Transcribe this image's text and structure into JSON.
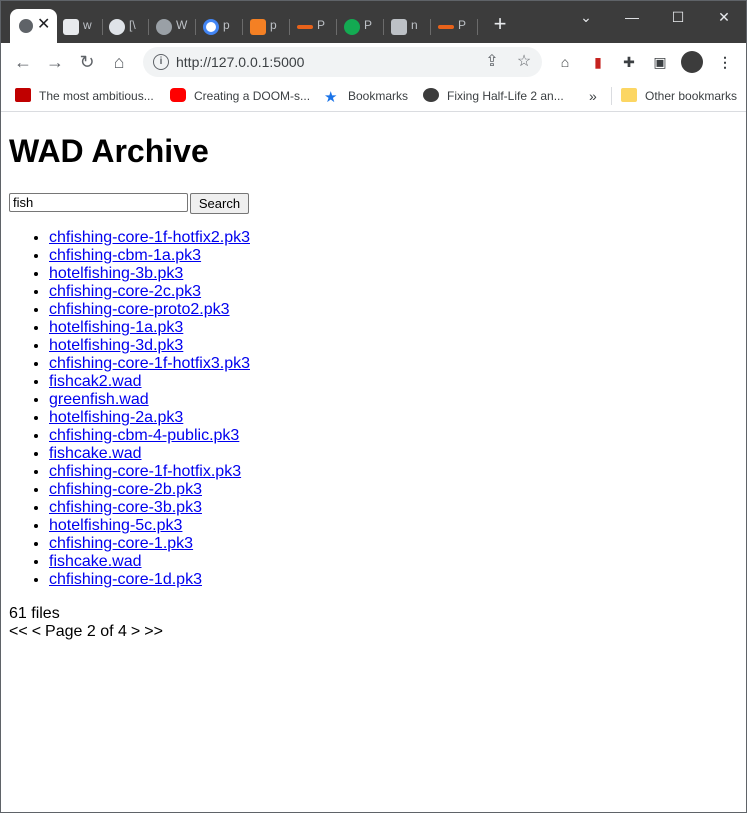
{
  "browser": {
    "tabs": [
      {
        "title": "w"
      },
      {
        "title": "[\\"
      },
      {
        "title": "W"
      },
      {
        "title": "p"
      },
      {
        "title": "p"
      },
      {
        "title": "P"
      },
      {
        "title": "P"
      },
      {
        "title": "n"
      },
      {
        "title": "P"
      }
    ],
    "new_tab_label": "+",
    "url": "http://127.0.0.1:5000",
    "bookmarks": [
      {
        "label": "The most ambitious...",
        "icon": "pcgamer-icon",
        "color": "#c00000"
      },
      {
        "label": "Creating a DOOM-s...",
        "icon": "youtube-icon",
        "color": "#ff0000"
      },
      {
        "label": "Bookmarks",
        "icon": "star-icon",
        "color": "#1a73e8"
      },
      {
        "label": "Fixing Half-Life 2 an...",
        "icon": "halflife-icon",
        "color": "#3c3c3c"
      }
    ],
    "bookmarks_overflow": "»",
    "other_bookmarks": "Other bookmarks"
  },
  "page": {
    "title": "WAD Archive",
    "search": {
      "value": "fish",
      "button_label": "Search"
    },
    "files": [
      "chfishing-core-1f-hotfix2.pk3",
      "chfishing-cbm-1a.pk3",
      "hotelfishing-3b.pk3",
      "chfishing-core-2c.pk3",
      "chfishing-core-proto2.pk3",
      "hotelfishing-1a.pk3",
      "hotelfishing-3d.pk3",
      "chfishing-core-1f-hotfix3.pk3",
      "fishcak2.wad",
      "greenfish.wad",
      "hotelfishing-2a.pk3",
      "chfishing-cbm-4-public.pk3",
      "fishcake.wad",
      "chfishing-core-1f-hotfix.pk3",
      "chfishing-core-2b.pk3",
      "chfishing-core-3b.pk3",
      "hotelfishing-5c.pk3",
      "chfishing-core-1.pk3",
      "fishcake.wad",
      "chfishing-core-1d.pk3"
    ],
    "file_count": "61 files",
    "pagination": {
      "first": "<<",
      "prev": "<",
      "label": "Page 2 of 4",
      "next": ">",
      "last": ">>"
    }
  }
}
